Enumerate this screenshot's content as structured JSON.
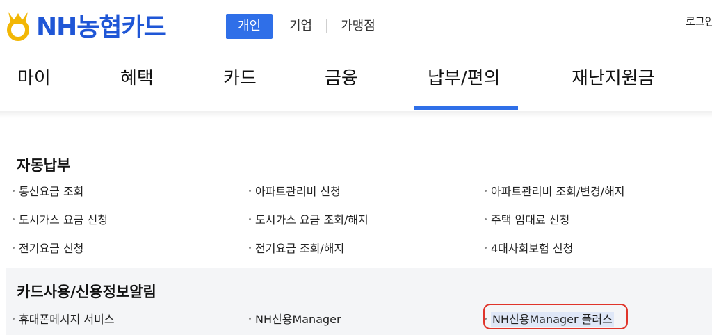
{
  "header": {
    "logo_text": "NH농협카드",
    "logo_icon": "nh-logo-icon",
    "segments": [
      {
        "label": "개인",
        "active": true
      },
      {
        "label": "기업",
        "active": false
      },
      {
        "label": "가맹점",
        "active": false
      }
    ],
    "login_label": "로그인"
  },
  "nav": {
    "items": [
      {
        "label": "마이"
      },
      {
        "label": "혜택"
      },
      {
        "label": "카드"
      },
      {
        "label": "금융"
      },
      {
        "label": "납부/편의",
        "active": true
      },
      {
        "label": "재난지원금"
      }
    ]
  },
  "sections": {
    "auto_pay": {
      "title": "자동납부",
      "items": [
        "통신요금 조회",
        "아파트관리비 신청",
        "아파트관리비 조회/변경/해지",
        "도시가스 요금 신청",
        "도시가스 요금 조회/해지",
        "주택 임대료 신청",
        "전기요금 신청",
        "전기요금 조회/해지",
        "4대사회보험 신청"
      ]
    },
    "card_alert": {
      "title": "카드사용/신용정보알림",
      "items": [
        "휴대폰메시지 서비스",
        "NH신용Manager",
        "NH신용Manager 플러스"
      ]
    }
  },
  "colors": {
    "brand_blue": "#1f56d6",
    "accent_blue": "#2f6fe8",
    "highlight_red": "#e0342a",
    "logo_yellow": "#f2b705"
  }
}
